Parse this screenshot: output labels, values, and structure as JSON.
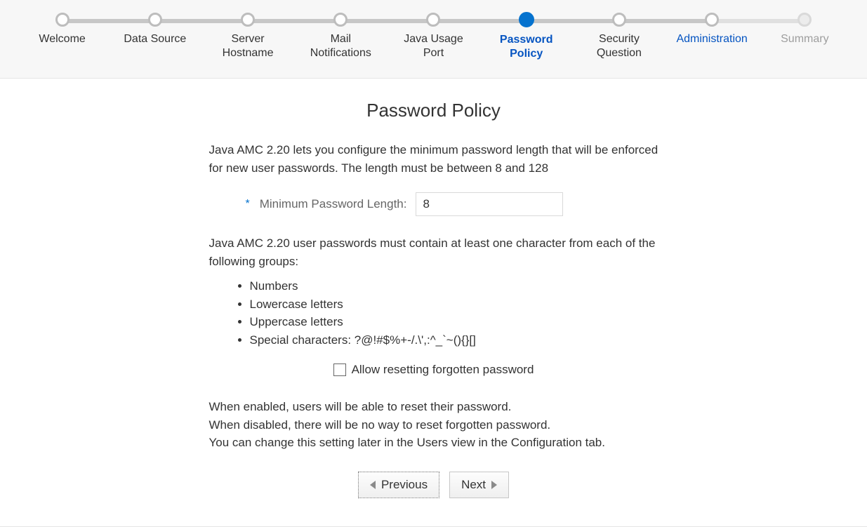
{
  "steps": [
    {
      "label": "Welcome",
      "state": "done"
    },
    {
      "label": "Data Source",
      "state": "done"
    },
    {
      "label": "Server\nHostname",
      "state": "done"
    },
    {
      "label": "Mail\nNotifications",
      "state": "done"
    },
    {
      "label": "Java Usage\nPort",
      "state": "done"
    },
    {
      "label": "Password\nPolicy",
      "state": "current"
    },
    {
      "label": "Security\nQuestion",
      "state": "done"
    },
    {
      "label": "Administration",
      "state": "link"
    },
    {
      "label": "Summary",
      "state": "future"
    }
  ],
  "page": {
    "title": "Password Policy",
    "intro": "Java AMC 2.20 lets you configure the minimum password length that will be enforced for new user passwords. The length must be between 8 and 128",
    "min_length_label": "Minimum Password Length:",
    "min_length_value": "8",
    "groups_intro": "Java AMC 2.20 user passwords must contain at least one character from each of the following groups:",
    "groups": [
      "Numbers",
      "Lowercase letters",
      "Uppercase letters",
      "Special characters: ?@!#$%+-/.\\',:^_`~(){}[]"
    ],
    "allow_reset_label": "Allow resetting forgotten password",
    "allow_reset_checked": false,
    "reset_help_1": "When enabled, users will be able to reset their password.",
    "reset_help_2": "When disabled, there will be no way to reset forgotten password.",
    "reset_help_3": "You can change this setting later in the Users view in the Configuration tab.",
    "prev_label": "Previous",
    "next_label": "Next"
  }
}
